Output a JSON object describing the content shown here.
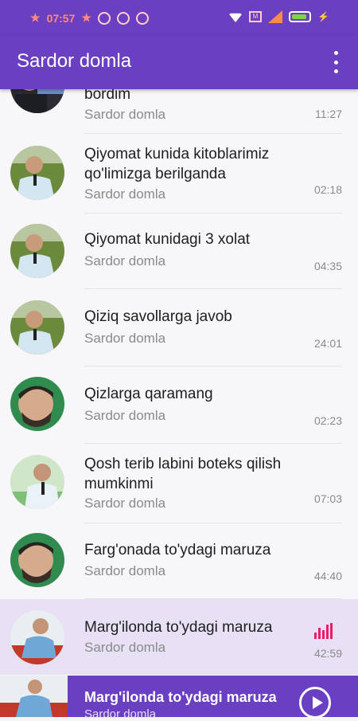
{
  "status_bar": {
    "time": "07:57",
    "accent": "#ff8a7a"
  },
  "app_bar": {
    "title": "Sardor domla",
    "color": "#6a3fc1"
  },
  "tracks": [
    {
      "title": "bordim",
      "artist": "Sardor domla",
      "duration": "11:27",
      "avatar": "dark-portrait"
    },
    {
      "title": "Qiyomat kunida kitoblarimiz qo'limizga berilganda",
      "artist": "Sardor domla",
      "duration": "02:18",
      "avatar": "speaker-green"
    },
    {
      "title": "Qiyomat kunidagi 3 xolat",
      "artist": "Sardor domla",
      "duration": "04:35",
      "avatar": "speaker-green"
    },
    {
      "title": "Qiziq savollarga javob",
      "artist": "Sardor domla",
      "duration": "24:01",
      "avatar": "speaker-green"
    },
    {
      "title": "Qizlarga qaramang",
      "artist": "Sardor domla",
      "duration": "02:23",
      "avatar": "closeup"
    },
    {
      "title": "Qosh terib labini boteks qilish mumkinmi",
      "artist": "Sardor domla",
      "duration": "07:03",
      "avatar": "speaker-light"
    },
    {
      "title": "Farg'onada to'ydagi maruza",
      "artist": "Sardor domla",
      "duration": "44:40",
      "avatar": "closeup"
    },
    {
      "title": "Marg'ilonda to'ydagi maruza",
      "artist": "Sardor domla",
      "duration": "42:59",
      "avatar": "seated-red",
      "playing": true
    }
  ],
  "now_playing": {
    "title": "Marg'ilonda to'ydagi maruza",
    "artist": "Sardor domla",
    "play_icon": "play-circle-icon"
  }
}
